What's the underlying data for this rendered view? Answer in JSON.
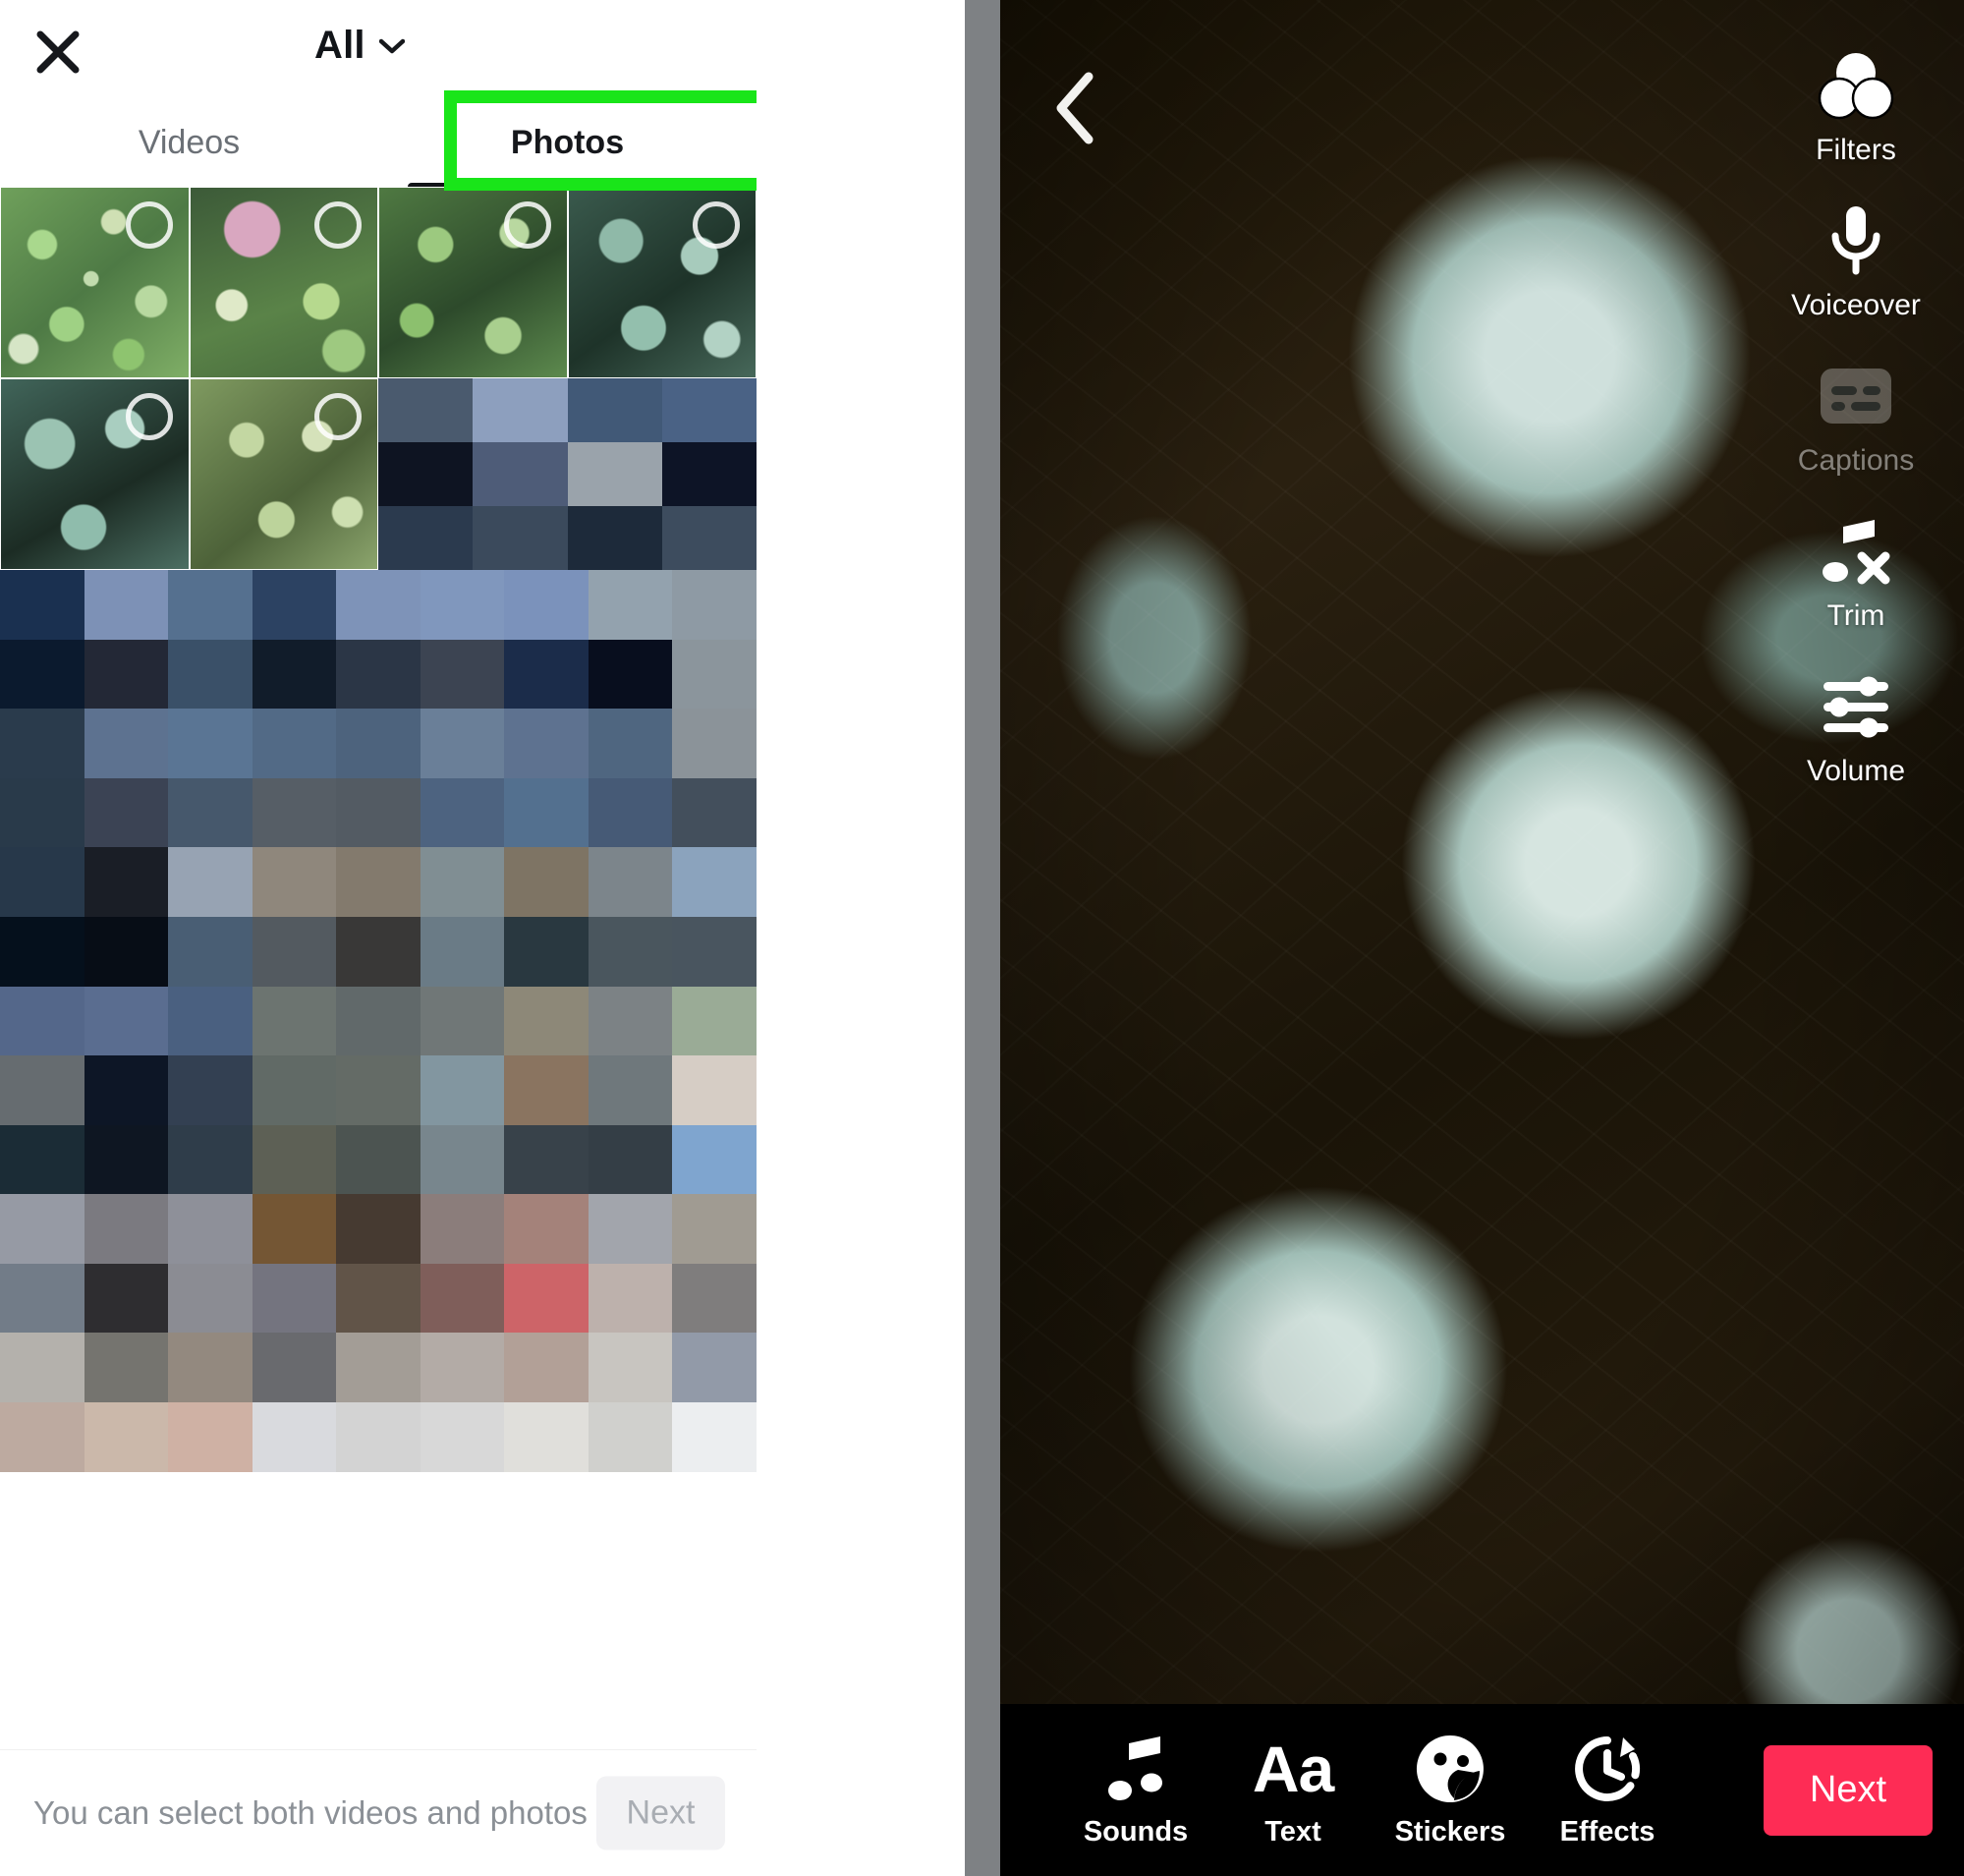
{
  "gallery_panel": {
    "close_icon": "close-icon",
    "filter": {
      "label": "All",
      "chevron": "chevron-down-icon"
    },
    "tabs": [
      {
        "label": "Videos",
        "active": false
      },
      {
        "label": "Photos",
        "active": true
      }
    ],
    "thumbnails": [
      {
        "name": "succulent-garden-mixed",
        "selected": false
      },
      {
        "name": "succulent-pink-rosette",
        "selected": false
      },
      {
        "name": "succulent-green-cluster",
        "selected": false
      },
      {
        "name": "succulent-teal-rosettes",
        "selected": false
      },
      {
        "name": "succulent-echeveria-blue",
        "selected": false
      },
      {
        "name": "succulent-pale-rosettes",
        "selected": false
      },
      {
        "name": "succulent-crowded-green",
        "selected": false
      }
    ],
    "hint_text": "You can select both videos and photos",
    "next_label": "Next",
    "next_enabled": false
  },
  "annotation": {
    "highlight_target": "Photos",
    "color": "#19E519"
  },
  "editor_panel": {
    "back_icon": "back-chevron-icon",
    "side_tools": [
      {
        "label": "Filters",
        "icon": "filters-icon",
        "disabled": false
      },
      {
        "label": "Voiceover",
        "icon": "microphone-icon",
        "disabled": false
      },
      {
        "label": "Captions",
        "icon": "captions-icon",
        "disabled": true
      },
      {
        "label": "Trim",
        "icon": "music-note-x-icon",
        "disabled": false
      },
      {
        "label": "Volume",
        "icon": "sliders-icon",
        "disabled": false
      }
    ],
    "bottom_tools": [
      {
        "label": "Sounds",
        "icon": "music-note-icon"
      },
      {
        "label": "Text",
        "icon": "text-aa-icon"
      },
      {
        "label": "Stickers",
        "icon": "sticker-face-icon"
      },
      {
        "label": "Effects",
        "icon": "effects-clock-icon"
      }
    ],
    "next_button": {
      "label": "Next",
      "color": "#FE2C55"
    }
  },
  "mosaic": {
    "block_a": [
      "#4a5a6e",
      "#8d9fbe",
      "#415977",
      "#4a6285",
      "#0e1422",
      "#4e5c78",
      "#9aa3ab",
      "#0d1426",
      "#2b3a4e",
      "#3b4a5c",
      "#1d2a3a",
      "#3d4c5e"
    ],
    "block_b": [
      "#1a3050",
      "#7d91b6",
      "#55708f",
      "#2c4262",
      "#7e93b8",
      "#8097bd",
      "#7b92bb",
      "#93a2ae",
      "#8e9aa4",
      "#0b1a2e",
      "#232836",
      "#3a5068",
      "#111c2a",
      "#2b3646",
      "#3c4452",
      "#1b2c4a",
      "#080e1e",
      "#8b959c",
      "#2a3b4c",
      "#5d7290",
      "#5a7594",
      "#526a86",
      "#4d637d",
      "#6a7f98",
      "#5e7290",
      "#4f6680",
      "#8b9399",
      "#293a4a",
      "#3b4354",
      "#46586c",
      "#565e66",
      "#535b63",
      "#4d6380",
      "#53708f",
      "#465a76",
      "#434f5c",
      "#27384a",
      "#1a1e26",
      "#97a3b3",
      "#8f877c",
      "#837a6d",
      "#808e93",
      "#7e7464",
      "#7c858b",
      "#8ba3bd",
      "#05101c",
      "#070d16",
      "#495e74",
      "#535a60",
      "#393837",
      "#6a7b86",
      "#293840",
      "#4a565e",
      "#49555f",
      "#54678a",
      "#5a6d90",
      "#4a6080",
      "#6c7470",
      "#61696a",
      "#707777",
      "#8d8878",
      "#7c8285",
      "#9aab96",
      "#666c70",
      "#0d1626",
      "#334052",
      "#616a66",
      "#646b66",
      "#8296a0",
      "#8a7460",
      "#6f787c",
      "#d6cdc5",
      "#1b2c36",
      "#0e1622",
      "#2f3d4a",
      "#5d6055",
      "#4c5451",
      "#78868d",
      "#38424a",
      "#343e46",
      "#7fa5cf",
      "#969aa4",
      "#7b7a80",
      "#8e9099",
      "#745634",
      "#463a31",
      "#8b7d7b",
      "#a4827a",
      "#a2a5ac",
      "#a09b92",
      "#727c88",
      "#2e2d30",
      "#8b8c93",
      "#74747f",
      "#615448",
      "#7f5e5a",
      "#cd6468",
      "#bdb1ac",
      "#7f7d7d",
      "#b4b1ac",
      "#75746f",
      "#93897f",
      "#696a6e",
      "#a39d96",
      "#b3aba6",
      "#b2a097",
      "#c8c5c0",
      "#929aa8",
      "#bdaaa0",
      "#cbb8aa",
      "#cfb1a4",
      "#d9dade",
      "#d3d3d3",
      "#d8d8d8",
      "#e0dfdb",
      "#d0d0cd",
      "#eceef0",
      "#ffffff",
      "#ffffff",
      "#ffffff",
      "#ffffff",
      "#ffffff",
      "#ffffff",
      "#ffffff",
      "#ffffff",
      "#ffffff",
      "#ffffff",
      "#ffffff",
      "#ffffff",
      "#ffffff",
      "#ffffff",
      "#ffffff",
      "#ffffff",
      "#ffffff",
      "#ffffff",
      "#ffffff",
      "#ffffff",
      "#ffffff",
      "#ffffff",
      "#ffffff",
      "#ffffff",
      "#ffffff",
      "#ffffff",
      "#ffffff",
      "#ffffff",
      "#ffffff",
      "#ffffff",
      "#ffffff",
      "#ffffff",
      "#ffffff",
      "#ffffff",
      "#ffffff",
      "#ffffff"
    ]
  }
}
